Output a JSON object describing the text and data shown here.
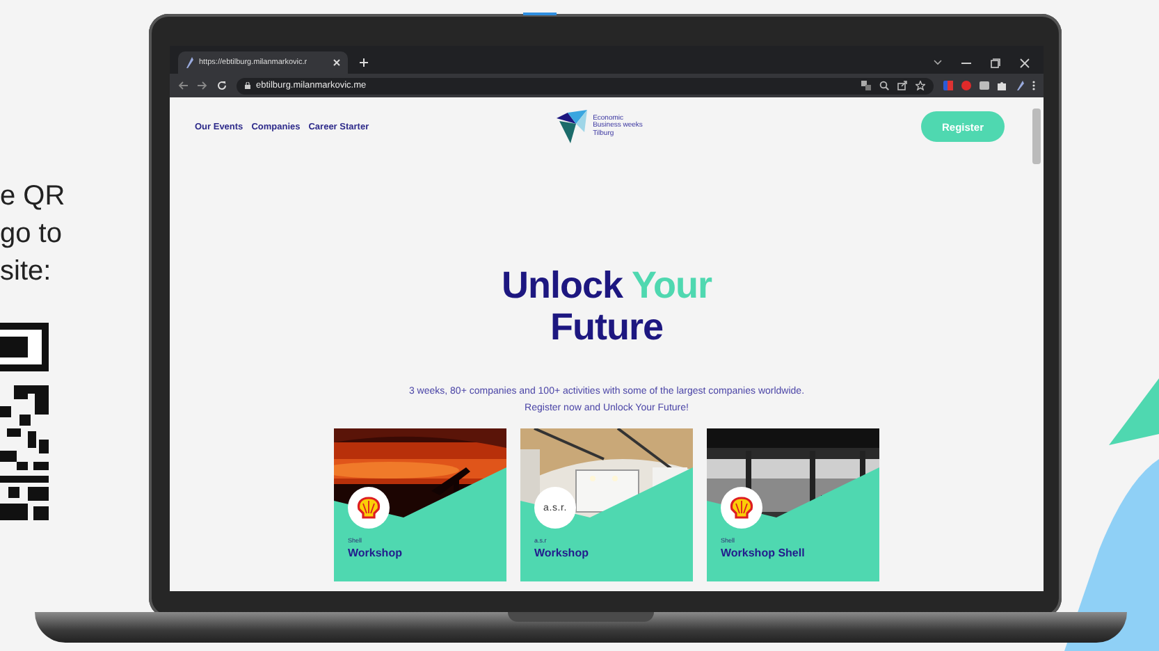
{
  "side_note": {
    "lines": [
      "e QR",
      "go to",
      "site:"
    ]
  },
  "browser": {
    "tab_title": "https://ebtilburg.milanmarkovic.r",
    "address": "ebtilburg.milanmarkovic.me"
  },
  "site": {
    "nav": [
      {
        "label": "Our Events"
      },
      {
        "label": "Companies"
      },
      {
        "label": "Career Starter"
      }
    ],
    "logo_lines": [
      "Economic",
      "Business weeks",
      "Tilburg"
    ],
    "register": "Register",
    "hero": {
      "title_line_1": [
        {
          "text": "Unlock",
          "accent": false
        },
        {
          "text": "Your",
          "accent": true
        }
      ],
      "title_line_2": "Future",
      "subtitle": "3 weeks, 80+ companies and 100+ activities with some of the largest companies worldwide. Register now and Unlock Your Future!"
    },
    "cards": [
      {
        "company": "Shell",
        "title": "Workshop",
        "logo": {
          "kind": "emblem"
        }
      },
      {
        "company": "a.s.r",
        "title": "Workshop",
        "logo": {
          "kind": "text",
          "text": "a.s.r."
        }
      },
      {
        "company": "Shell",
        "title": "Workshop Shell",
        "logo": {
          "kind": "emblem"
        }
      }
    ]
  }
}
